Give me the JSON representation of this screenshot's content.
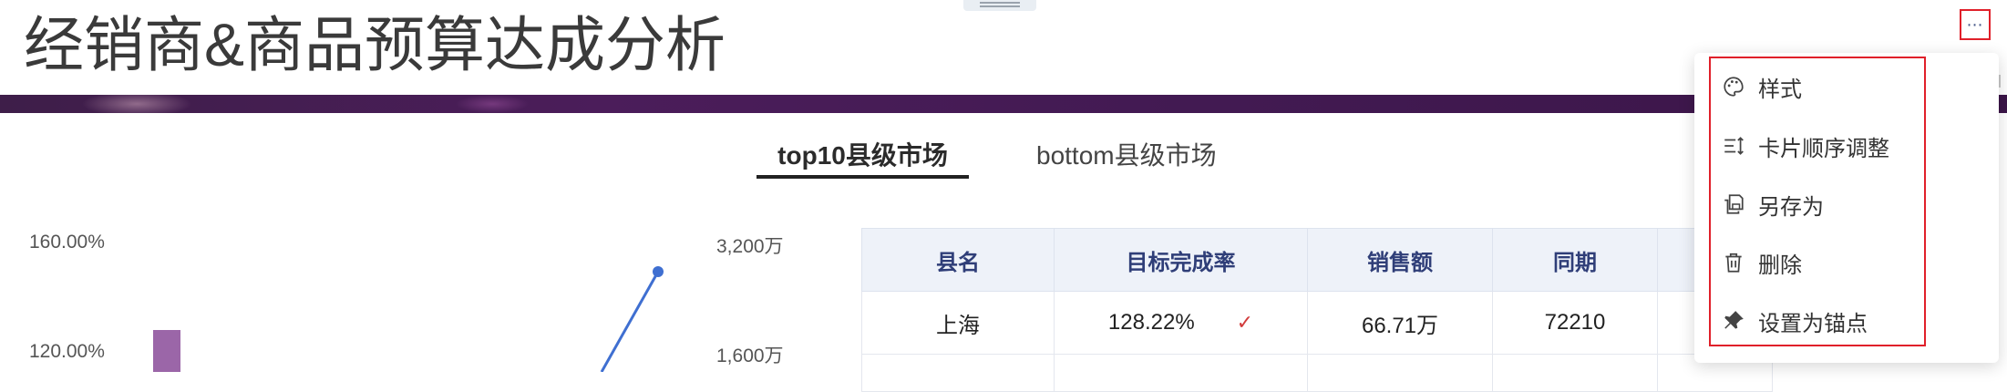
{
  "page": {
    "title": "经销商&商品预算达成分析"
  },
  "colors": {
    "banner": "#4b1d5a",
    "bar": "#9b66a8",
    "line": "#3f6fd1",
    "highlight": "#e0202a",
    "table_header_text": "#2f3e78"
  },
  "tabs": [
    {
      "label": "top10县级市场",
      "active": true
    },
    {
      "label": "bottom县级市场",
      "active": false
    }
  ],
  "chart": {
    "y_left_ticks": [
      "160.00%",
      "120.00%"
    ],
    "y_right_ticks": [
      "3,200万",
      "1,600万"
    ]
  },
  "table": {
    "headers": [
      "县名",
      "目标完成率",
      "销售额",
      "同期"
    ],
    "rows": [
      {
        "county": "上海",
        "completion": "128.22%",
        "status_icon": "checkmark-icon",
        "sales": "66.71万",
        "same_period": "72210"
      }
    ]
  },
  "menu": {
    "trigger_icon": "more-icon",
    "items": [
      {
        "label": "样式",
        "icon": "palette-icon"
      },
      {
        "label": "卡片顺序调整",
        "icon": "reorder-icon"
      },
      {
        "label": "另存为",
        "icon": "save-as-icon"
      },
      {
        "label": "删除",
        "icon": "trash-icon"
      },
      {
        "label": "设置为锚点",
        "icon": "pin-icon"
      }
    ]
  }
}
